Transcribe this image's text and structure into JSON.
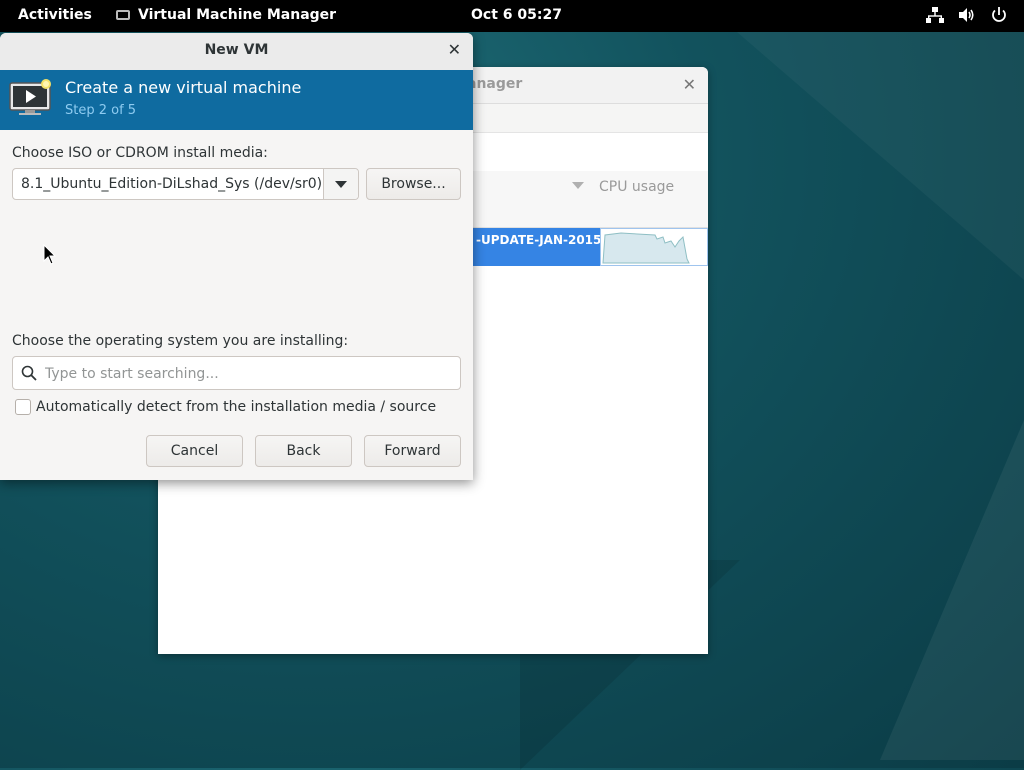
{
  "topbar": {
    "activities": "Activities",
    "app_name": "Virtual Machine Manager",
    "clock": "Oct 6  05:27",
    "tray_icons": [
      "network-icon",
      "volume-icon",
      "power-icon"
    ]
  },
  "background_window": {
    "title_partial": "anager",
    "column_cpu": "CPU usage",
    "selected_row_text": "-UPDATE-JAN-2015",
    "accent_color": "#3584e4"
  },
  "dialog": {
    "title": "New VM",
    "banner": {
      "title": "Create a new virtual machine",
      "step": "Step 2 of 5",
      "color": "#0f6ba0"
    },
    "media_label": "Choose ISO or CDROM install media:",
    "media_value": "8.1_Ubuntu_Edition-DiLshad_Sys (/dev/sr0)",
    "browse_label": "Browse...",
    "os_label": "Choose the operating system you are installing:",
    "os_search_placeholder": "Type to start searching...",
    "autodetect_label": "Automatically detect from the installation media / source",
    "autodetect_checked": false,
    "buttons": {
      "cancel": "Cancel",
      "back": "Back",
      "forward": "Forward"
    }
  }
}
